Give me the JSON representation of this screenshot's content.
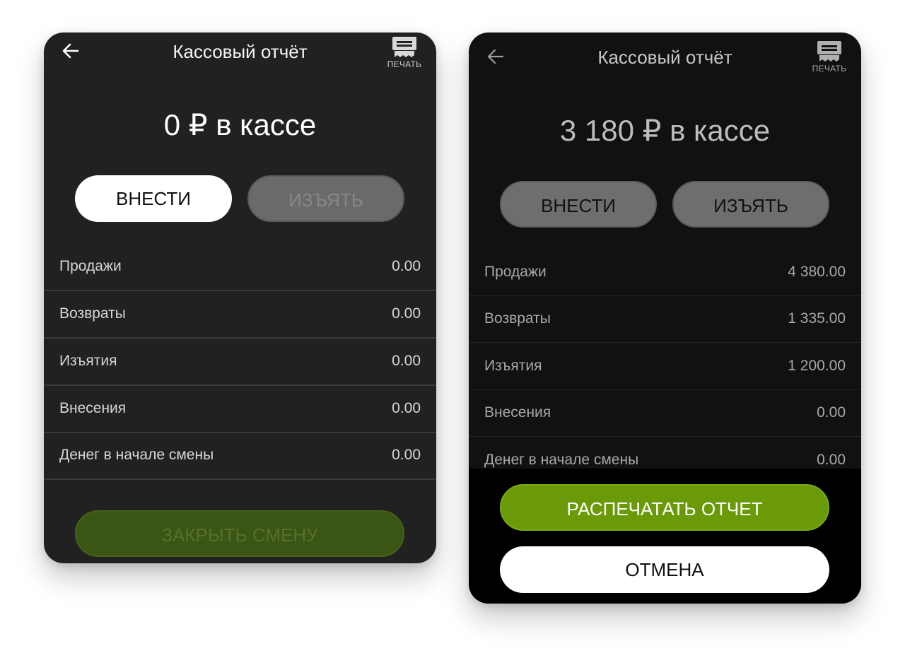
{
  "left_screen": {
    "header": {
      "title": "Кассовый отчёт",
      "print_label": "ПЕЧАТЬ"
    },
    "balance": "0 ₽ в кассе",
    "buttons": {
      "deposit": "ВНЕСТИ",
      "withdraw": "ИЗЪЯТЬ",
      "close_shift": "ЗАКРЫТЬ СМЕНУ"
    },
    "rows": [
      {
        "label": "Продажи",
        "value": "0.00"
      },
      {
        "label": "Возвраты",
        "value": "0.00"
      },
      {
        "label": "Изъятия",
        "value": "0.00"
      },
      {
        "label": "Внесения",
        "value": "0.00"
      },
      {
        "label": "Денег в начале смены",
        "value": "0.00"
      }
    ]
  },
  "right_screen": {
    "header": {
      "title": "Кассовый отчёт",
      "print_label": "ПЕЧАТЬ"
    },
    "balance": "3 180 ₽ в кассе",
    "buttons": {
      "deposit": "ВНЕСТИ",
      "withdraw": "ИЗЪЯТЬ"
    },
    "rows": [
      {
        "label": "Продажи",
        "value": "4 380.00"
      },
      {
        "label": "Возвраты",
        "value": "1 335.00"
      },
      {
        "label": "Изъятия",
        "value": "1 200.00"
      },
      {
        "label": "Внесения",
        "value": "0.00"
      },
      {
        "label": "Денег в начале смены",
        "value": "0.00"
      }
    ],
    "sheet": {
      "print_report": "РАСПЕЧАТАТЬ ОТЧЕТ",
      "cancel": "ОТМЕНА"
    }
  },
  "colors": {
    "accent_green": "#6a9a07",
    "accent_green_disabled": "#3a5514",
    "background_dark": "#212121",
    "background_darker": "#111111"
  },
  "icons": {
    "back": "arrow-left-icon",
    "print": "printer-icon"
  }
}
